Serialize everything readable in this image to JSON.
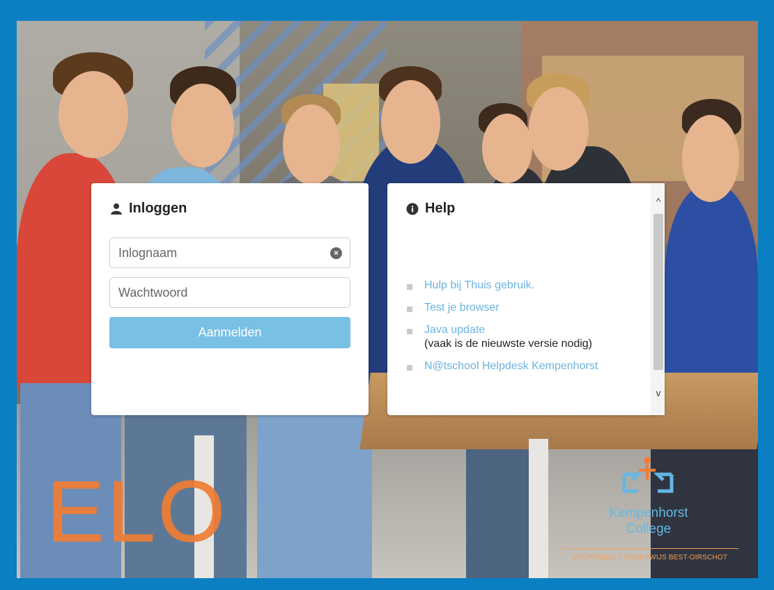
{
  "login": {
    "title": "Inloggen",
    "icon": "user-icon",
    "username_placeholder": "Inlognaam",
    "password_placeholder": "Wachtwoord",
    "button_label": "Aanmelden"
  },
  "help": {
    "title": "Help",
    "icon": "info-icon",
    "links": [
      {
        "label": "Hulp bij Thuis gebruik."
      },
      {
        "label": "Test je browser"
      },
      {
        "label": "Java update",
        "note": "(vaak is de nieuwste versie nodig)"
      },
      {
        "label": "N@tschool Helpdesk Kempenhorst"
      }
    ]
  },
  "branding": {
    "elo_text": "ELO",
    "school_name_line1": "Kempenhorst",
    "school_name_line2": "College",
    "school_subtitle": "VOORTGEZET ONDERWIJS BEST-OIRSCHOT"
  },
  "colors": {
    "frame_blue": "#0a7fc2",
    "button_blue": "#78c0e4",
    "link_blue": "#6bb3de",
    "elo_orange": "#f07d34"
  }
}
